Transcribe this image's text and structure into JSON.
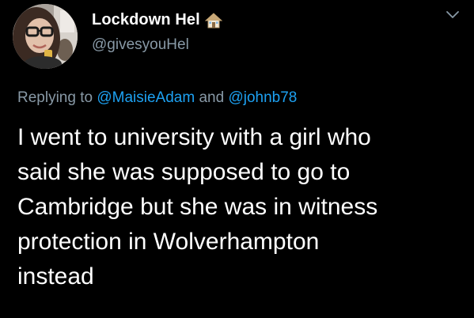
{
  "author": {
    "display_name": "Lockdown Hel",
    "name_emoji_icon": "house-icon",
    "handle": "@givesyouHel",
    "avatar_icon": "profile-photo"
  },
  "menu": {
    "caret_icon": "chevron-down-icon"
  },
  "reply": {
    "prefix": "Replying to",
    "mention_1": "@MaisieAdam",
    "conjunction": "and",
    "mention_2": "@johnb78"
  },
  "tweet": {
    "lines": [
      "I went to university with a girl who",
      "said she was supposed to go to",
      "Cambridge but she was in witness",
      "protection in Wolverhampton",
      "instead"
    ]
  },
  "colors": {
    "background": "#000000",
    "text_primary": "#ffffff",
    "text_secondary": "#8899a6",
    "link": "#1da1f2"
  }
}
